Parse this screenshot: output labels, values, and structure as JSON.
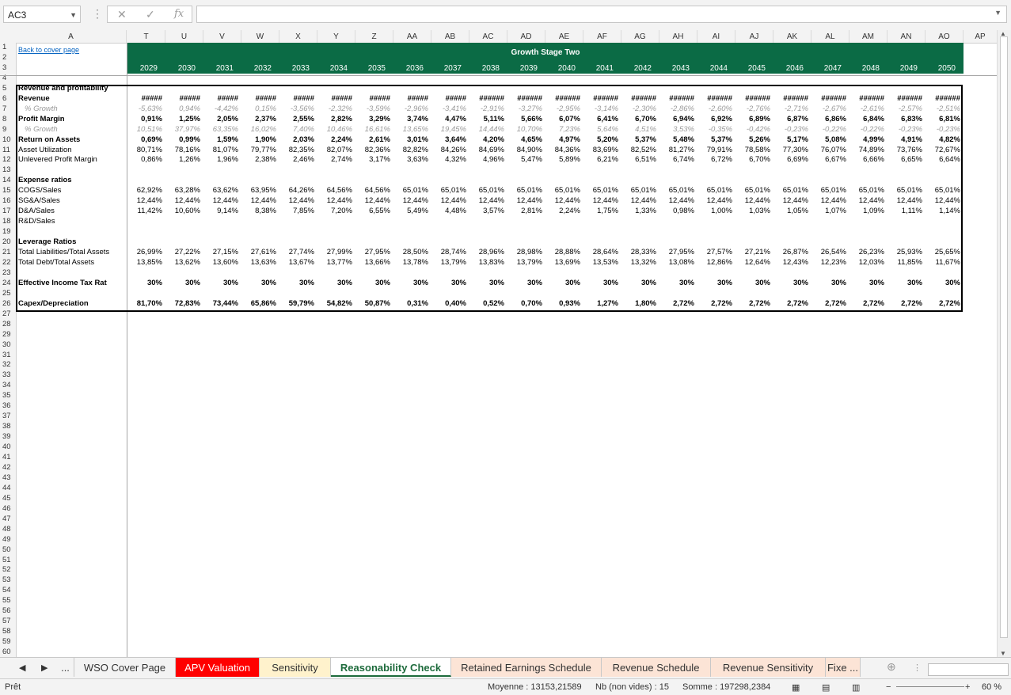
{
  "namebox": "AC3",
  "fx_label": "fx",
  "sheet": {
    "link": "Back to cover page",
    "banner_title": "Growth Stage Two",
    "columns": [
      "A",
      "T",
      "U",
      "V",
      "W",
      "X",
      "Y",
      "Z",
      "AA",
      "AB",
      "AC",
      "AD",
      "AE",
      "AF",
      "AG",
      "AH",
      "AI",
      "AJ",
      "AK",
      "AL",
      "AM",
      "AN",
      "AO",
      "AP"
    ],
    "years": [
      "2029",
      "2030",
      "2031",
      "2032",
      "2033",
      "2034",
      "2035",
      "2036",
      "2037",
      "2038",
      "2039",
      "2040",
      "2041",
      "2042",
      "2043",
      "2044",
      "2045",
      "2046",
      "2047",
      "2048",
      "2049",
      "2050"
    ]
  },
  "rows": [
    {
      "r": 5,
      "label": "Revenue and profitability",
      "style": "b",
      "vals": []
    },
    {
      "r": 6,
      "label": "Revenue",
      "style": "b",
      "vals": [
        "#####",
        "#####",
        "#####",
        "#####",
        "#####",
        "#####",
        "#####",
        "#####",
        "#####",
        "######",
        "######",
        "######",
        "######",
        "######",
        "######",
        "######",
        "######",
        "######",
        "######",
        "######",
        "######",
        "######"
      ]
    },
    {
      "r": 7,
      "label": "% Growth",
      "style": "it",
      "vals": [
        "-5,63%",
        "0,94%",
        "-4,42%",
        "0,15%",
        "-3,56%",
        "-2,32%",
        "-3,59%",
        "-2,96%",
        "-3,41%",
        "-2,91%",
        "-3,27%",
        "-2,95%",
        "-3,14%",
        "-2,30%",
        "-2,86%",
        "-2,60%",
        "-2,76%",
        "-2,71%",
        "-2,67%",
        "-2,61%",
        "-2,57%",
        "-2,51%"
      ]
    },
    {
      "r": 8,
      "label": "Profit Margin",
      "style": "b",
      "vals": [
        "0,91%",
        "1,25%",
        "2,05%",
        "2,37%",
        "2,55%",
        "2,82%",
        "3,29%",
        "3,74%",
        "4,47%",
        "5,11%",
        "5,66%",
        "6,07%",
        "6,41%",
        "6,70%",
        "6,94%",
        "6,92%",
        "6,89%",
        "6,87%",
        "6,86%",
        "6,84%",
        "6,83%",
        "6,81%"
      ]
    },
    {
      "r": 9,
      "label": "% Growth",
      "style": "it",
      "vals": [
        "10,51%",
        "37,97%",
        "63,35%",
        "16,02%",
        "7,40%",
        "10,46%",
        "16,61%",
        "13,65%",
        "19,45%",
        "14,44%",
        "10,70%",
        "7,23%",
        "5,64%",
        "4,51%",
        "3,53%",
        "-0,35%",
        "-0,42%",
        "-0,23%",
        "-0,22%",
        "-0,22%",
        "-0,23%",
        "-0,23%"
      ]
    },
    {
      "r": 10,
      "label": "Return on Assets",
      "style": "b",
      "vals": [
        "0,69%",
        "0,99%",
        "1,59%",
        "1,90%",
        "2,03%",
        "2,24%",
        "2,61%",
        "3,01%",
        "3,64%",
        "4,20%",
        "4,65%",
        "4,97%",
        "5,20%",
        "5,37%",
        "5,48%",
        "5,37%",
        "5,26%",
        "5,17%",
        "5,08%",
        "4,99%",
        "4,91%",
        "4,82%"
      ]
    },
    {
      "r": 11,
      "label": "Asset Utilization",
      "style": "",
      "vals": [
        "80,71%",
        "78,16%",
        "81,07%",
        "79,77%",
        "82,35%",
        "82,07%",
        "82,36%",
        "82,82%",
        "84,26%",
        "84,69%",
        "84,90%",
        "84,36%",
        "83,69%",
        "82,52%",
        "81,27%",
        "79,91%",
        "78,58%",
        "77,30%",
        "76,07%",
        "74,89%",
        "73,76%",
        "72,67%"
      ]
    },
    {
      "r": 12,
      "label": "Unlevered Profit Margin",
      "style": "",
      "vals": [
        "0,86%",
        "1,26%",
        "1,96%",
        "2,38%",
        "2,46%",
        "2,74%",
        "3,17%",
        "3,63%",
        "4,32%",
        "4,96%",
        "5,47%",
        "5,89%",
        "6,21%",
        "6,51%",
        "6,74%",
        "6,72%",
        "6,70%",
        "6,69%",
        "6,67%",
        "6,66%",
        "6,65%",
        "6,64%"
      ]
    },
    {
      "r": 14,
      "label": "Expense ratios",
      "style": "b",
      "vals": []
    },
    {
      "r": 15,
      "label": "COGS/Sales",
      "style": "",
      "vals": [
        "62,92%",
        "63,28%",
        "63,62%",
        "63,95%",
        "64,26%",
        "64,56%",
        "64,56%",
        "65,01%",
        "65,01%",
        "65,01%",
        "65,01%",
        "65,01%",
        "65,01%",
        "65,01%",
        "65,01%",
        "65,01%",
        "65,01%",
        "65,01%",
        "65,01%",
        "65,01%",
        "65,01%",
        "65,01%"
      ]
    },
    {
      "r": 16,
      "label": "SG&A/Sales",
      "style": "",
      "vals": [
        "12,44%",
        "12,44%",
        "12,44%",
        "12,44%",
        "12,44%",
        "12,44%",
        "12,44%",
        "12,44%",
        "12,44%",
        "12,44%",
        "12,44%",
        "12,44%",
        "12,44%",
        "12,44%",
        "12,44%",
        "12,44%",
        "12,44%",
        "12,44%",
        "12,44%",
        "12,44%",
        "12,44%",
        "12,44%"
      ]
    },
    {
      "r": 17,
      "label": "D&A/Sales",
      "style": "",
      "vals": [
        "11,42%",
        "10,60%",
        "9,14%",
        "8,38%",
        "7,85%",
        "7,20%",
        "6,55%",
        "5,49%",
        "4,48%",
        "3,57%",
        "2,81%",
        "2,24%",
        "1,75%",
        "1,33%",
        "0,98%",
        "1,00%",
        "1,03%",
        "1,05%",
        "1,07%",
        "1,09%",
        "1,11%",
        "1,14%"
      ]
    },
    {
      "r": 18,
      "label": "R&D/Sales",
      "style": "",
      "vals": []
    },
    {
      "r": 20,
      "label": "Leverage Ratios",
      "style": "b",
      "vals": []
    },
    {
      "r": 21,
      "label": "Total Liabilities/Total Assets",
      "style": "",
      "vals": [
        "26,99%",
        "27,22%",
        "27,15%",
        "27,61%",
        "27,74%",
        "27,99%",
        "27,95%",
        "28,50%",
        "28,74%",
        "28,96%",
        "28,98%",
        "28,88%",
        "28,64%",
        "28,33%",
        "27,95%",
        "27,57%",
        "27,21%",
        "26,87%",
        "26,54%",
        "26,23%",
        "25,93%",
        "25,65%"
      ]
    },
    {
      "r": 22,
      "label": "Total Debt/Total Assets",
      "style": "",
      "vals": [
        "13,85%",
        "13,62%",
        "13,60%",
        "13,63%",
        "13,67%",
        "13,77%",
        "13,66%",
        "13,78%",
        "13,79%",
        "13,83%",
        "13,79%",
        "13,69%",
        "13,53%",
        "13,32%",
        "13,08%",
        "12,86%",
        "12,64%",
        "12,43%",
        "12,23%",
        "12,03%",
        "11,85%",
        "11,67%"
      ]
    },
    {
      "r": 24,
      "label": "Effective Income Tax Rat",
      "style": "b",
      "vals": [
        "30%",
        "30%",
        "30%",
        "30%",
        "30%",
        "30%",
        "30%",
        "30%",
        "30%",
        "30%",
        "30%",
        "30%",
        "30%",
        "30%",
        "30%",
        "30%",
        "30%",
        "30%",
        "30%",
        "30%",
        "30%",
        "30%"
      ]
    },
    {
      "r": 26,
      "label": "Capex/Depreciation",
      "style": "b",
      "vals": [
        "81,70%",
        "72,83%",
        "73,44%",
        "65,86%",
        "59,79%",
        "54,82%",
        "50,87%",
        "0,31%",
        "0,40%",
        "0,52%",
        "0,70%",
        "0,93%",
        "1,27%",
        "1,80%",
        "2,72%",
        "2,72%",
        "2,72%",
        "2,72%",
        "2,72%",
        "2,72%",
        "2,72%",
        "2,72%"
      ]
    }
  ],
  "tabs": [
    {
      "label": "...",
      "bg": "#f3f3f3",
      "color": "#333",
      "w": 22
    },
    {
      "label": "WSO Cover Page",
      "bg": "#f3f3f3",
      "color": "#333",
      "w": 128
    },
    {
      "label": "APV Valuation",
      "bg": "#ff0000",
      "color": "#ffffff",
      "w": 106
    },
    {
      "label": "Sensitivity",
      "bg": "#fff2cc",
      "color": "#333",
      "w": 90
    },
    {
      "label": "Reasonability Check",
      "bg": "#ffffff",
      "color": "#1e6b3c",
      "w": 152,
      "active": true
    },
    {
      "label": "Retained Earnings Schedule",
      "bg": "#fce4d6",
      "color": "#333",
      "w": 190
    },
    {
      "label": "Revenue Schedule",
      "bg": "#fce4d6",
      "color": "#333",
      "w": 138
    },
    {
      "label": "Revenue Sensitivity",
      "bg": "#fce4d6",
      "color": "#333",
      "w": 145
    },
    {
      "label": "Fixe ...",
      "bg": "#fce4d6",
      "color": "#333",
      "w": 44
    }
  ],
  "status": {
    "ready": "Prêt",
    "average": "Moyenne : 13153,21589",
    "count": "Nb (non vides) : 15",
    "sum": "Somme : 197298,2384",
    "zoom": "60 %"
  },
  "colors": {
    "banner": "#0b6b45",
    "link": "#0563c1",
    "active_tab_text": "#1e6b3c"
  }
}
